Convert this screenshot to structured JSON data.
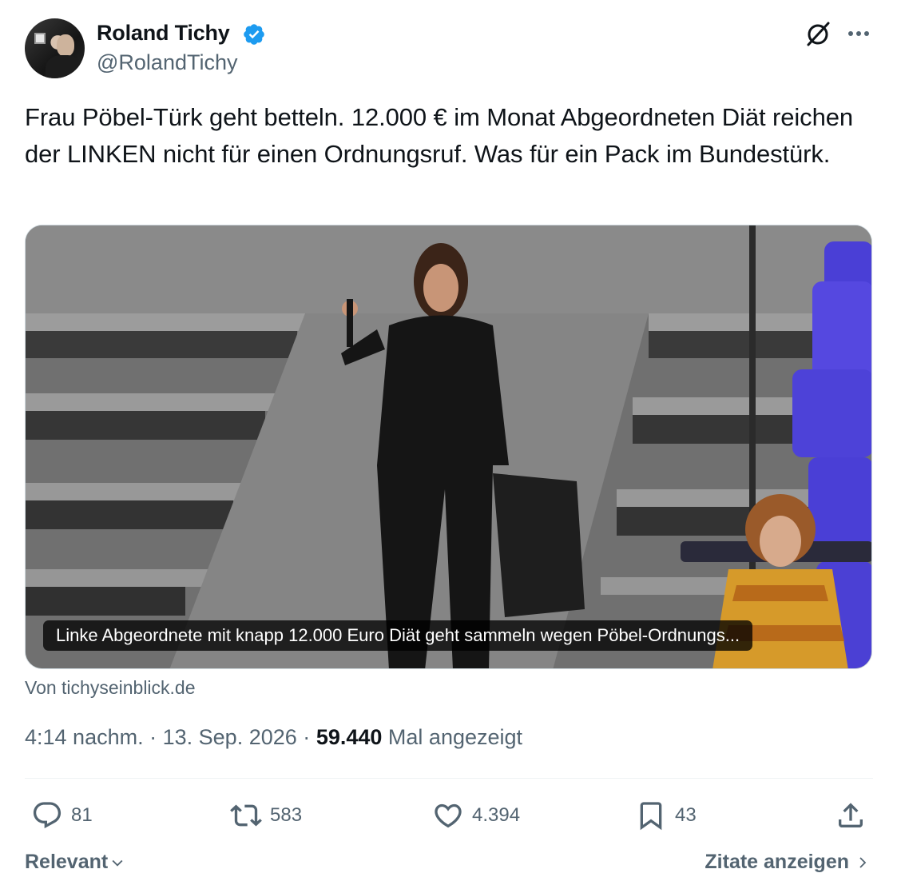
{
  "author": {
    "display_name": "Roland Tichy",
    "handle": "@RolandTichy",
    "verified_icon": "verified-badge-icon"
  },
  "header_icons": [
    "grok-icon",
    "more-icon"
  ],
  "tweet": {
    "text": "Frau Pöbel-Türk geht betteln. 12.000 € im Monat Abgeordneten Diät reichen der LINKEN nicht für einen Ordnungsruf. Was für ein Pack im Bundestürk."
  },
  "link_card": {
    "caption": "Linke Abgeordnete mit knapp 12.000 Euro Diät geht sammeln wegen Pöbel-Ordnungs...",
    "source": "Von tichyseinblick.de"
  },
  "meta": {
    "time": "4:14 nachm.",
    "separator": "·",
    "date": "13. Sep. 2026",
    "views": "59.440",
    "views_label": "Mal angezeigt"
  },
  "actions": {
    "replies": "81",
    "retweets": "583",
    "likes": "4.394",
    "bookmarks": "43"
  },
  "footer": {
    "sort_label": "Relevant",
    "quotes_label": "Zitate anzeigen"
  },
  "colors": {
    "text": "#0f1419",
    "secondary": "#536471",
    "verified": "#1d9bf0",
    "divider": "#eff3f4"
  }
}
